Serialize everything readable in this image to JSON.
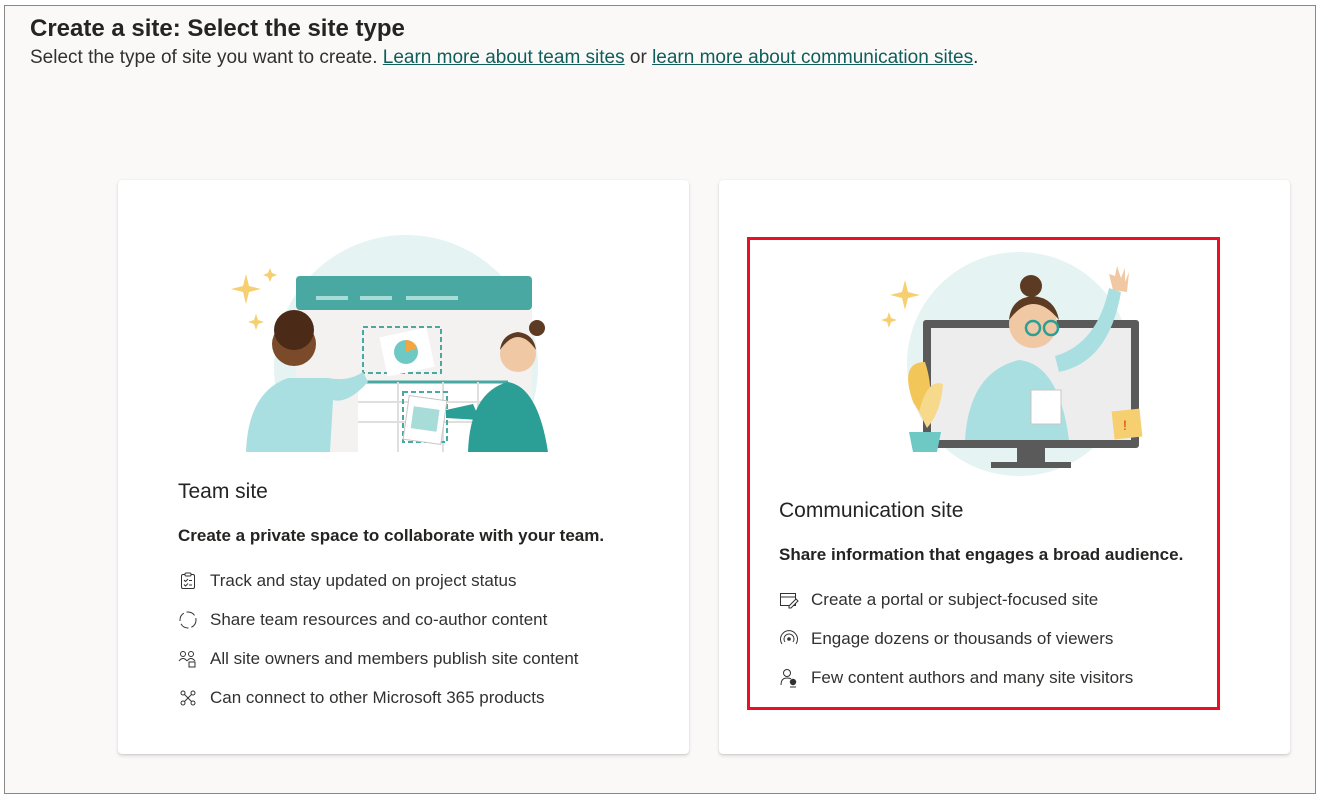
{
  "header": {
    "title": "Create a site: Select the site type",
    "subtitle_prefix": "Select the type of site you want to create. ",
    "link_team": "Learn more about team sites",
    "subtitle_or": " or ",
    "link_comm": "learn more about communication sites",
    "subtitle_suffix": "."
  },
  "team_card": {
    "title": "Team site",
    "description": "Create a private space to collaborate with your team.",
    "features": [
      {
        "icon": "checklist-icon",
        "label": "Track and stay updated on project status"
      },
      {
        "icon": "sync-circle-icon",
        "label": "Share team resources and co-author content"
      },
      {
        "icon": "people-network-icon",
        "label": "All site owners and members publish site content"
      },
      {
        "icon": "connect-nodes-icon",
        "label": "Can connect to other Microsoft 365 products"
      }
    ]
  },
  "comm_card": {
    "title": "Communication site",
    "description": "Share information that engages a broad audience.",
    "features": [
      {
        "icon": "portal-edit-icon",
        "label": "Create a portal or subject-focused site"
      },
      {
        "icon": "broadcast-icon",
        "label": "Engage dozens or thousands of viewers"
      },
      {
        "icon": "author-visitors-icon",
        "label": "Few content authors and many site visitors"
      }
    ]
  },
  "colors": {
    "link": "#0f5e5a",
    "highlight_border": "#e81123",
    "teal": "#3fa8a0",
    "light_teal": "#bfe7e7"
  }
}
